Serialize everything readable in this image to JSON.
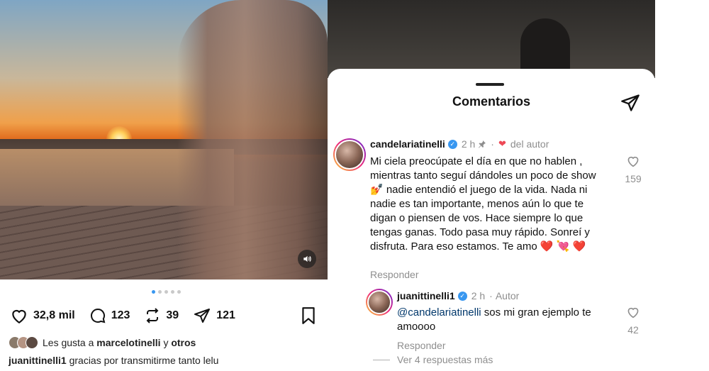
{
  "post": {
    "actions": {
      "likes": "32,8 mil",
      "comments": "123",
      "reposts": "39",
      "shares": "121"
    },
    "liked_by": {
      "prefix": "Les gusta a",
      "user": "marcelotinelli",
      "connector": "y",
      "others": "otros"
    },
    "caption": {
      "user": "juanittinelli1",
      "text": "gracias por transmitirme tanto lelu"
    },
    "carousel": {
      "count": 5,
      "active_index": 0
    },
    "icons": [
      "heart-icon",
      "comment-icon",
      "repost-icon",
      "share-icon",
      "bookmark-icon",
      "sound-icon"
    ]
  },
  "comments_sheet": {
    "title": "Comentarios",
    "comments": [
      {
        "user": "candelariatinelli",
        "time": "2 h",
        "author_like": "del autor",
        "text": "Mi ciela preocúpate el día en que no hablen , mientras tanto seguí dándoles un poco de show 💅 nadie entendió el juego de la vida. Nada ni nadie es tan importante, menos aún lo que te digan o piensen de vos. Hace siempre lo que tengas ganas. Todo pasa muy rápido. Sonreí y disfruta. Para eso estamos. Te amo ❤️ 💘 ❤️",
        "reply_label": "Responder",
        "likes": "159"
      },
      {
        "user": "juanittinelli1",
        "time": "2 h",
        "badge": "Autor",
        "mention": "@candelariatinelli",
        "text": "sos mi gran ejemplo te amoooo",
        "reply_label": "Responder",
        "likes": "42"
      }
    ],
    "view_replies": "Ver 4 respuestas más"
  },
  "colors": {
    "accent_blue": "#3897f0",
    "heart_red": "#ed4956",
    "mention": "#00376b",
    "muted": "#8e8e8e"
  }
}
